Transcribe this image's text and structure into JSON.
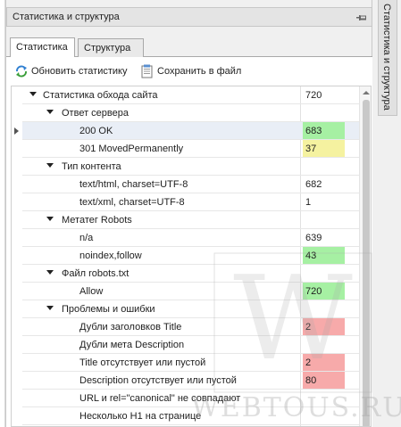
{
  "panel": {
    "title": "Статистика и структура"
  },
  "side_tab": {
    "label": "Статистика и структура"
  },
  "tabs": [
    {
      "label": "Статистика",
      "active": true
    },
    {
      "label": "Структура",
      "active": false
    }
  ],
  "toolbar": {
    "refresh_label": "Обновить статистику",
    "save_label": "Сохранить в файл"
  },
  "tree": {
    "root": {
      "label": "Статистика обхода сайта",
      "value": "720"
    },
    "groups": [
      {
        "label": "Ответ сервера",
        "items": [
          {
            "label": "200 OK",
            "value": "683",
            "color": "#a6f0a3"
          },
          {
            "label": "301 MovedPermanently",
            "value": "37",
            "color": "#f5f2a0"
          }
        ]
      },
      {
        "label": "Тип контента",
        "items": [
          {
            "label": "text/html, charset=UTF-8",
            "value": "682"
          },
          {
            "label": "text/xml, charset=UTF-8",
            "value": "1"
          }
        ]
      },
      {
        "label": "Метатег Robots",
        "items": [
          {
            "label": "n/a",
            "value": "639"
          },
          {
            "label": "noindex,follow",
            "value": "43",
            "color": "#a6f0a3"
          }
        ]
      },
      {
        "label": "Файл robots.txt",
        "items": [
          {
            "label": "Allow",
            "value": "720",
            "color": "#a6f0a3"
          }
        ]
      },
      {
        "label": "Проблемы и ошибки",
        "items": [
          {
            "label": "Дубли заголовков Title",
            "value": "2",
            "color": "#f7aaaa"
          },
          {
            "label": "Дубли мета Description",
            "value": ""
          },
          {
            "label": "Title отсутствует или пустой",
            "value": "2",
            "color": "#f7aaaa"
          },
          {
            "label": "Description отсутствует или пустой",
            "value": "80",
            "color": "#f7aaaa"
          },
          {
            "label": "URL и rel=\"canonical\" не совпадают",
            "value": ""
          },
          {
            "label": "Несколько H1 на странице",
            "value": ""
          }
        ]
      }
    ]
  },
  "watermark": {
    "text": "WEBTOUS.RU"
  }
}
